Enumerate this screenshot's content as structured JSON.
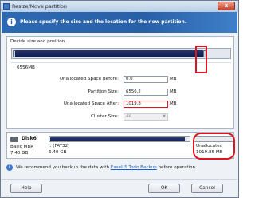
{
  "window": {
    "title": "Resize/Move partition",
    "close_label": "x"
  },
  "banner": {
    "text": "Please specify the size and the location for the new partition."
  },
  "group": {
    "title": "Decide size and position",
    "slider_size": "6556MB",
    "slider_fill_fraction": 0.855
  },
  "fields": [
    {
      "label": "Unallocated Space Before:",
      "value": "0.0",
      "unit": "MB"
    },
    {
      "label": "Partition Size:",
      "value": "6556.2",
      "unit": "MB"
    },
    {
      "label": "Unallocated Space After:",
      "value": "1019.8",
      "unit": "MB"
    },
    {
      "label": "Cluster Size:",
      "value": "4K",
      "unit": ""
    }
  ],
  "disk": {
    "name": "Disk6",
    "type": "Basic MBR",
    "size": "7.40 GB",
    "partition": {
      "name": "I: (FAT32)",
      "size": "6.40 GB",
      "fill_fraction": 0.97
    },
    "unallocated": {
      "name": "Unallocated",
      "size": "1019.85 MB"
    }
  },
  "backup": {
    "prefix": "We recommend you backup the data with ",
    "link": "EaseUS Todo Backup",
    "suffix": " before operation."
  },
  "buttons": {
    "help": "Help",
    "ok": "OK",
    "cancel": "Cancel"
  },
  "colors": {
    "banner": "#2d69b3",
    "highlight": "#e0141e",
    "partition_fill": "#142258"
  }
}
